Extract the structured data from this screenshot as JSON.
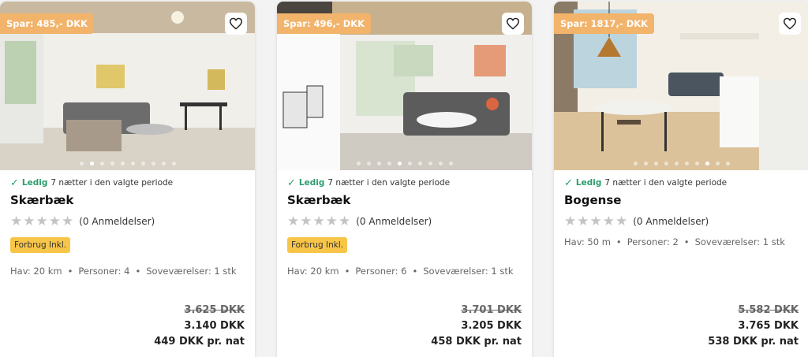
{
  "cards": [
    {
      "save_badge": "Spar: 485,- DKK",
      "availability_status": "Ledig",
      "availability_text": "7 nætter i den valgte periode",
      "city": "Skærbæk",
      "reviews": "(0 Anmeldelser)",
      "badge": "Forbrug Inkl.",
      "facts": {
        "sea": "Hav: 20 km",
        "persons": "Personer: 4",
        "bedrooms": "Soveværelser: 1 stk"
      },
      "price_old": "3.625 DKK",
      "price_new": "3.140 DKK",
      "price_per_night": "449 DKK pr. nat"
    },
    {
      "save_badge": "Spar: 496,- DKK",
      "availability_status": "Ledig",
      "availability_text": "7 nætter i den valgte periode",
      "city": "Skærbæk",
      "reviews": "(0 Anmeldelser)",
      "badge": "Forbrug Inkl.",
      "facts": {
        "sea": "Hav: 20 km",
        "persons": "Personer: 6",
        "bedrooms": "Soveværelser: 1 stk"
      },
      "price_old": "3.701 DKK",
      "price_new": "3.205 DKK",
      "price_per_night": "458 DKK pr. nat"
    },
    {
      "save_badge": "Spar: 1817,- DKK",
      "availability_status": "Ledig",
      "availability_text": "7 nætter i den valgte periode",
      "city": "Bogense",
      "reviews": "(0 Anmeldelser)",
      "badge": "",
      "facts": {
        "sea": "Hav: 50 m",
        "persons": "Personer: 2",
        "bedrooms": "Soveværelser: 1 stk"
      },
      "price_old": "5.582 DKK",
      "price_new": "3.765 DKK",
      "price_per_night": "538 DKK pr. nat"
    }
  ],
  "icons": {
    "favorite": "heart-outline-icon",
    "available": "checkmark-icon",
    "rating": "star-icon"
  },
  "colors": {
    "save_badge": "#f2b36b",
    "available": "#2a9d6b",
    "inclusive_badge": "#f7c548",
    "star_empty": "#c4c4c4"
  }
}
